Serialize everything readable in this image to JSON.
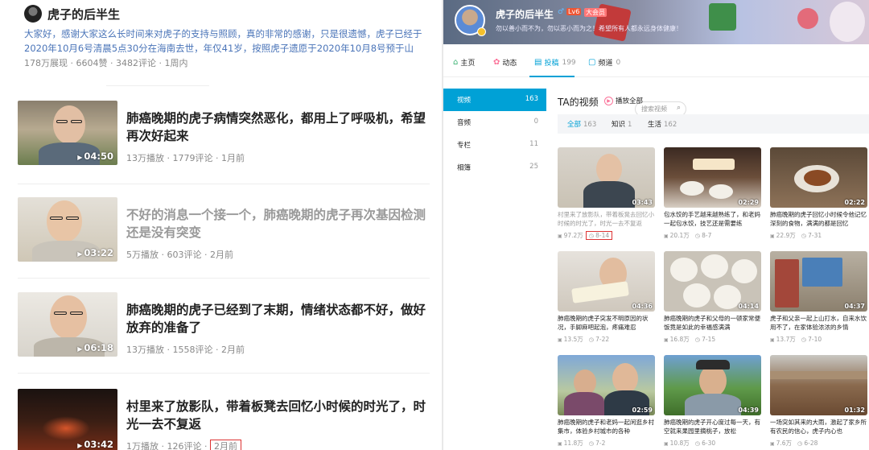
{
  "left": {
    "author": "虎子的后半生",
    "post_text": "大家好，感谢大家这么长时间来对虎子的支持与照顾，真的非常的感谢，只是很遗憾，虎子已经于2020年10月6号清晨5点30分在海南去世，年仅41岁，按照虎子遗愿于2020年10月8号预于山东老家潍...",
    "post_stats": "178万展现 · 6604赞 · 3482评论 · 1周内",
    "videos": [
      {
        "title": "肺癌晚期的虎子病情突然恶化，都用上了呼吸机，希望再次好起来",
        "duration": "04:50",
        "plays": "13万播放",
        "comments": "1779评论",
        "time": "1月前"
      },
      {
        "title": "不好的消息一个接一个，肺癌晚期的虎子再次基因检测还是没有突变",
        "duration": "03:22",
        "plays": "5万播放",
        "comments": "603评论",
        "time": "2月前"
      },
      {
        "title": "肺癌晚期的虎子已经到了末期，情绪状态都不好，做好放弃的准备了",
        "duration": "06:18",
        "plays": "13万播放",
        "comments": "1558评论",
        "time": "2月前"
      },
      {
        "title": "村里来了放影队，带着板凳去回忆小时候的时光了，时光一去不复返",
        "duration": "03:42",
        "plays": "1万播放",
        "comments": "126评论",
        "time": "2月前"
      }
    ]
  },
  "right": {
    "name": "虎子的后半生",
    "gender": "♂",
    "level": "Lv6",
    "vip": "大会员",
    "sign": "勿以善小而不为，勿以恶小而为之！希望所有人都永远身体健康！",
    "nav": [
      {
        "icon": "⌂",
        "label": "主页",
        "count": ""
      },
      {
        "icon": "✿",
        "label": "动态",
        "count": ""
      },
      {
        "icon": "▤",
        "label": "投稿",
        "count": "199"
      },
      {
        "icon": "▢",
        "label": "频道",
        "count": "0"
      }
    ],
    "search_placeholder": "搜索视频",
    "side": [
      {
        "label": "视频",
        "count": "163"
      },
      {
        "label": "音频",
        "count": "0"
      },
      {
        "label": "专栏",
        "count": "11"
      },
      {
        "label": "相簿",
        "count": "25"
      }
    ],
    "section_title": "TA的视频",
    "play_all": "播放全部",
    "filters": [
      {
        "label": "全部",
        "count": "163"
      },
      {
        "label": "知识",
        "count": "1"
      },
      {
        "label": "生活",
        "count": "162"
      }
    ],
    "cards": [
      {
        "title": "村里来了放影队，带着板凳去回忆小时候的时光了，时光一去不复返",
        "duration": "03:43",
        "plays": "97.2万",
        "date": "8-14"
      },
      {
        "title": "包水饺的手艺越来越熟练了，和老妈一起包水饺，技艺还是需要练",
        "duration": "02:29",
        "plays": "20.1万",
        "date": "8-7"
      },
      {
        "title": "肺癌晚期的虎子回忆小时候令他记忆深刻的食物，满满的都是回忆",
        "duration": "02:22",
        "plays": "22.9万",
        "date": "7-31"
      },
      {
        "title": "肺癌晚期的虎子突发不明原因的状况，手脚麻吧起泡，疼痛难忍",
        "duration": "04:36",
        "plays": "13.5万",
        "date": "7-22"
      },
      {
        "title": "肺癌晚期的虎子和父母的一顿家常便饭竟是如此的幸福感满满",
        "duration": "04:14",
        "plays": "16.8万",
        "date": "7-15"
      },
      {
        "title": "虎子和父亲一起上山打水，自来水饮用不了，在家体验浓浓的乡情",
        "duration": "04:37",
        "plays": "13.7万",
        "date": "7-10"
      },
      {
        "title": "肺癌晚期的虎子和老妈一起闲逛乡村集市，体验乡村城市的各种",
        "duration": "02:59",
        "plays": "11.8万",
        "date": "7-2"
      },
      {
        "title": "肺癌晚期的虎子开心度过每一天，有空就来果园里摘桃子，放松",
        "duration": "04:39",
        "plays": "10.8万",
        "date": "6-30"
      },
      {
        "title": "一场突如其来的大雨，激起了家乡所有农民的信心，虎子内心也",
        "duration": "01:32",
        "plays": "7.6万",
        "date": "6-28"
      }
    ]
  }
}
